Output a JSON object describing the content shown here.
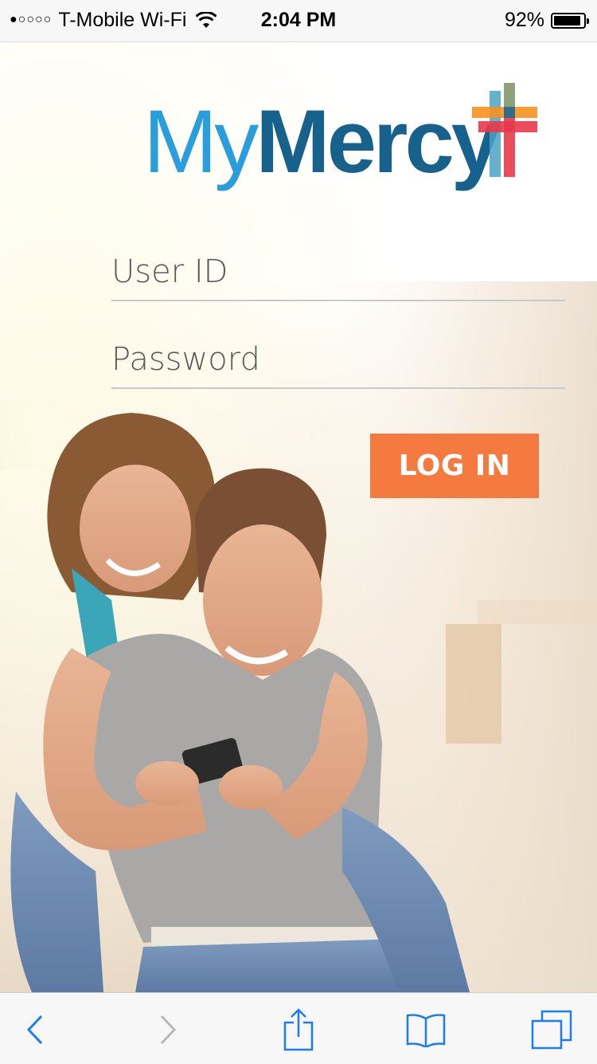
{
  "status_bar": {
    "signal_dots": "●○○○○",
    "carrier": "T-Mobile Wi-Fi",
    "time": "2:04 PM",
    "battery_percent": "92%",
    "battery_level": 0.92,
    "icons": [
      "wifi-icon",
      "battery-icon"
    ]
  },
  "logo": {
    "part1": "My",
    "part2": "Mercy",
    "colors": {
      "my": "#2a9ddc",
      "mercy": "#17618d",
      "cross_red": "#e8394a",
      "cross_orange": "#f6921e",
      "cross_teal": "#4aa3c4",
      "cross_olive": "#8ea27a"
    }
  },
  "form": {
    "user_id_placeholder": "User ID",
    "password_placeholder": "Password",
    "login_label": "LOG IN",
    "login_color": "#f47a3f"
  },
  "toolbar": {
    "icons": [
      "back-icon",
      "forward-icon",
      "share-icon",
      "bookmarks-icon",
      "tabs-icon"
    ],
    "accent": "#1a7ef2"
  }
}
